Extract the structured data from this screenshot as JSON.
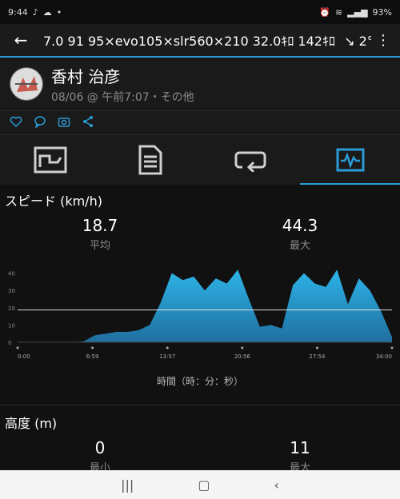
{
  "status": {
    "time": "9:44",
    "icons_left": [
      "tiktok-icon",
      "cloud-icon",
      "tiktok-icon",
      "dot-icon"
    ],
    "icons_right": [
      "alarm-icon",
      "mute-icon",
      "wifi-icon",
      "signal-icon"
    ],
    "battery": "93%"
  },
  "appbar": {
    "title": "7.0 91 95×evo105×slr560×210 32.0ｷﾛ 142ｷﾛ",
    "weather_icon": "wind-arrow-icon",
    "temperature": "2°C"
  },
  "activity": {
    "name": "香村 治彦",
    "meta": "08/06 @ 午前7:07・その他"
  },
  "actions": [
    "like-icon",
    "comment-icon",
    "camera-icon",
    "share-icon"
  ],
  "tabs": [
    {
      "name": "overview",
      "icon": "map-icon",
      "active": false
    },
    {
      "name": "details",
      "icon": "document-icon",
      "active": false
    },
    {
      "name": "laps",
      "icon": "loop-icon",
      "active": false
    },
    {
      "name": "charts",
      "icon": "chart-icon",
      "active": true
    }
  ],
  "speed": {
    "title": "スピード (km/h)",
    "avg_value": "18.7",
    "avg_label": "平均",
    "max_value": "44.3",
    "max_label": "最大"
  },
  "elevation": {
    "title": "高度 (m)",
    "min_value": "0",
    "min_label": "最小",
    "max_value": "11",
    "max_label": "最大"
  },
  "chart_data": {
    "type": "area",
    "title": "スピード (km/h)",
    "xlabel": "時間（時：分：秒）",
    "ylabel": "",
    "ylim": [
      0,
      50
    ],
    "y_ticks": [
      "0",
      "10",
      "20",
      "30",
      "40"
    ],
    "x_ticks": [
      "0:00",
      "6:59",
      "13:57",
      "20:56",
      "27:54",
      "34:00"
    ],
    "average_line": 18.7,
    "x": [
      0,
      1,
      2,
      3,
      4,
      5,
      6,
      7,
      8,
      9,
      10,
      11,
      12,
      13,
      14,
      15,
      16,
      17,
      18,
      19,
      20,
      21,
      22,
      23,
      24,
      25,
      26,
      27,
      28,
      29,
      30,
      31,
      32,
      33,
      34
    ],
    "values": [
      0,
      0,
      0,
      0,
      0,
      0,
      0.5,
      4,
      5,
      6,
      6,
      7,
      10,
      23,
      40,
      36,
      38,
      30,
      37,
      34,
      42,
      25,
      9,
      10,
      8,
      33,
      40,
      34,
      32,
      42,
      22,
      37,
      30,
      18,
      3
    ]
  },
  "navbar": [
    "recent-apps-icon",
    "home-icon",
    "back-icon"
  ]
}
